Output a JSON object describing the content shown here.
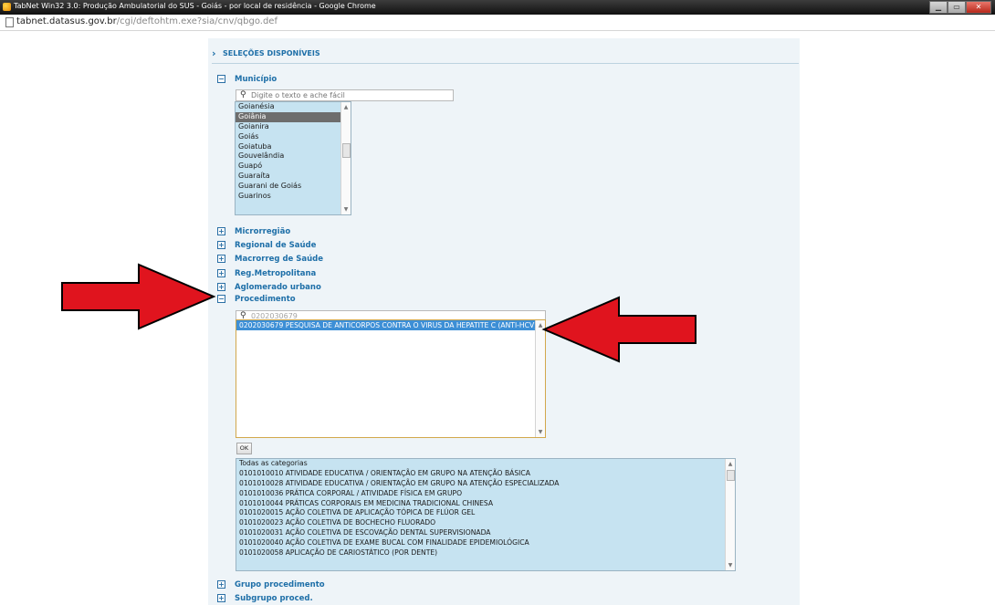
{
  "window": {
    "title": "TabNet Win32 3.0: Produção Ambulatorial do SUS - Goiás - por local de residência - Google Chrome"
  },
  "address": {
    "host": "tabnet.datasus.gov.br",
    "path": "/cgi/deftohtm.exe?sia/cnv/qbgo.def"
  },
  "section": {
    "title": "SELEÇÕES DISPONÍVEIS"
  },
  "municipio": {
    "label": "Município",
    "toggle": "−",
    "placeholder": "Digite o texto e ache fácil",
    "items": [
      "Goianésia",
      "Goiânia",
      "Goianira",
      "Goiás",
      "Goiatuba",
      "Gouvelândia",
      "Guapó",
      "Guaraíta",
      "Guarani de Goiás",
      "Guarinos"
    ],
    "selected": "Goiânia"
  },
  "collapsed": [
    {
      "label": "Microrregião",
      "toggle": "+"
    },
    {
      "label": "Regional de Saúde",
      "toggle": "+"
    },
    {
      "label": "Macrorreg de Saúde",
      "toggle": "+"
    },
    {
      "label": "Reg.Metropolitana",
      "toggle": "+"
    },
    {
      "label": "Aglomerado urbano",
      "toggle": "+"
    }
  ],
  "procedimento": {
    "label": "Procedimento",
    "toggle": "−",
    "search_value": "0202030679",
    "selected_item": "0202030679 PESQUISA DE ANTICORPOS CONTRA O VIRUS DA HEPATITE C (ANTI-HCV)",
    "ok_label": "OK",
    "categories": [
      "Todas as categorias",
      "0101010010 ATIVIDADE EDUCATIVA / ORIENTAÇÃO EM GRUPO NA ATENÇÃO BÁSICA",
      "0101010028 ATIVIDADE EDUCATIVA / ORIENTAÇÃO EM GRUPO NA ATENÇÃO ESPECIALIZADA",
      "0101010036 PRÁTICA CORPORAL / ATIVIDADE FÍSICA EM GRUPO",
      "0101010044 PRÁTICAS CORPORAIS EM MEDICINA TRADICIONAL CHINESA",
      "0101020015 AÇÃO COLETIVA DE APLICAÇÃO TÓPICA DE FLÚOR GEL",
      "0101020023 AÇÃO COLETIVA DE BOCHECHO FLUORADO",
      "0101020031 AÇÃO COLETIVA DE ESCOVAÇÃO DENTAL SUPERVISIONADA",
      "0101020040 AÇÃO COLETIVA DE EXAME BUCAL COM FINALIDADE EPIDEMIOLÓGICA",
      "0101020058 APLICAÇÃO DE CARIOSTÁTICO (POR DENTE)"
    ]
  },
  "bottom": [
    {
      "label": "Grupo procedimento",
      "toggle": "+"
    },
    {
      "label": "Subgrupo proced.",
      "toggle": "+"
    }
  ],
  "colors": {
    "arrow": "#e0141e",
    "label": "#1e6fa8",
    "list_bg": "#c6e3f1",
    "highlight": "#3d8fd6"
  },
  "icons": {
    "search": "magnifier-icon",
    "app": "chrome-app-icon"
  }
}
